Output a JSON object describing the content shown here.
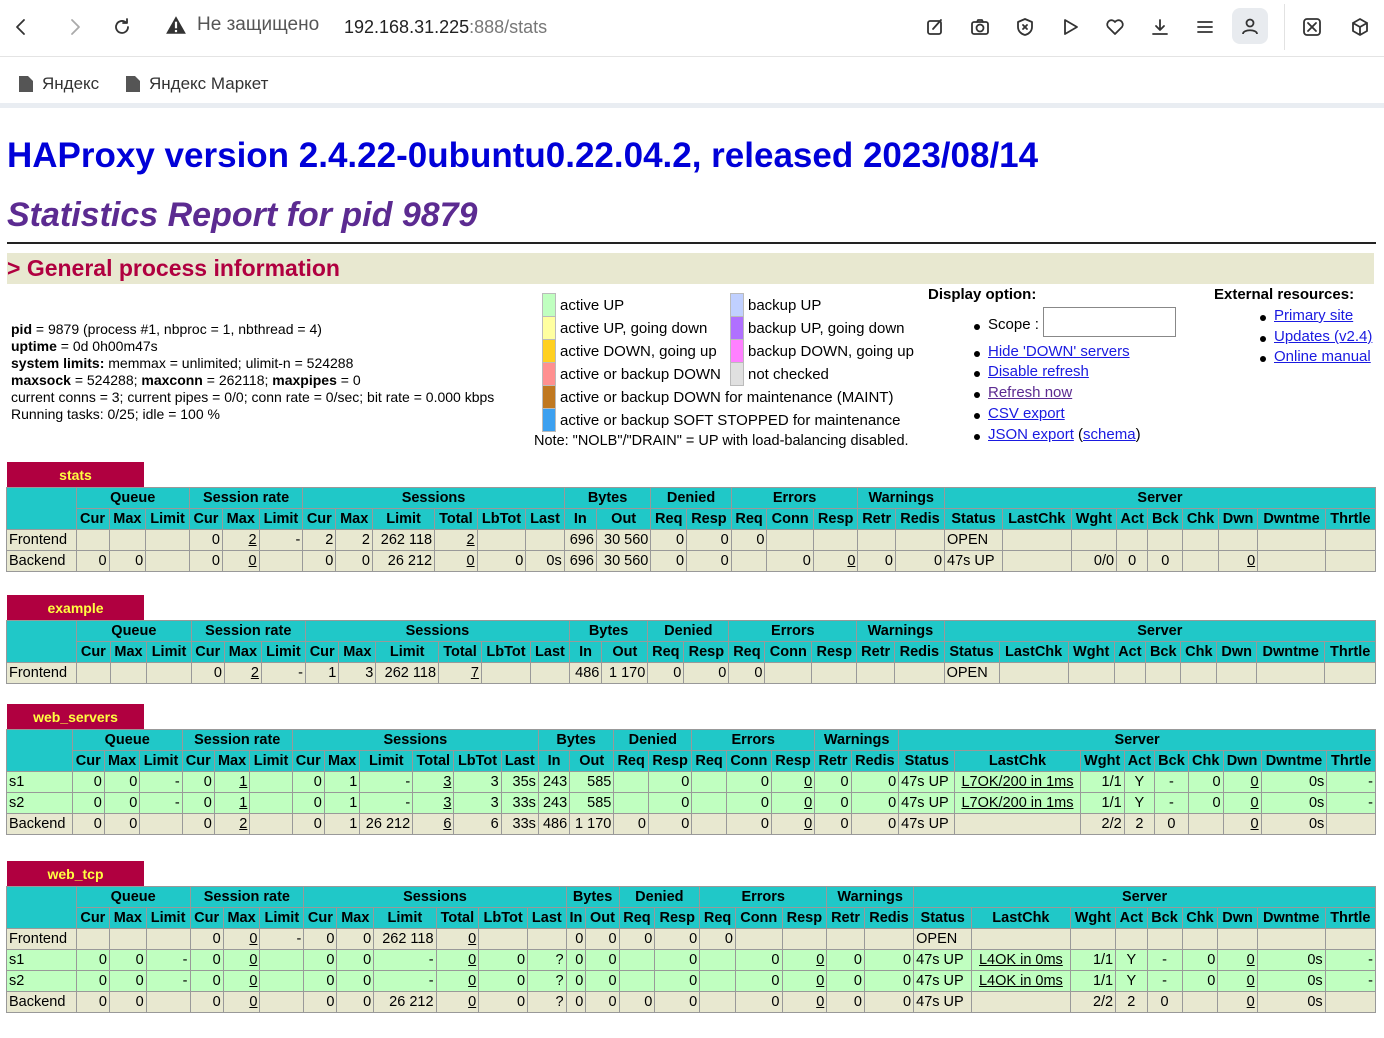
{
  "browser": {
    "security_label": "Не защищено",
    "url_host": "192.168.31.225",
    "url_rest": ":888/stats",
    "bookmarks": [
      "Яндекс",
      "Яндекс Маркет"
    ]
  },
  "header": {
    "title": "HAProxy version 2.4.22-0ubuntu0.22.04.2, released 2023/08/14",
    "subtitle": "Statistics Report for pid 9879",
    "section": "> General process information"
  },
  "process": {
    "line1_k": "pid",
    "line1_v": " = 9879 (process #1, nbproc = 1, nbthread = 4)",
    "line2_k": "uptime",
    "line2_v": " = 0d 0h00m47s",
    "line3_k": "system limits:",
    "line3_v": " memmax = unlimited; ulimit-n = 524288",
    "line4_k1": "maxsock",
    "line4_v1": " = 524288; ",
    "line4_k2": "maxconn",
    "line4_v2": " = 262118; ",
    "line4_k3": "maxpipes",
    "line4_v3": " = 0",
    "line5": "current conns = 3; current pipes = 0/0; conn rate = 0/sec; bit rate = 0.000 kbps",
    "line6": "Running tasks: 0/25; idle = 100 %"
  },
  "legend": {
    "items": [
      {
        "label": "active UP",
        "color": "#c0ffc0"
      },
      {
        "label": "active UP, going down",
        "color": "#ffffa0"
      },
      {
        "label": "active DOWN, going up",
        "color": "#ffd020"
      },
      {
        "label": "active or backup DOWN",
        "color": "#ff9090"
      },
      {
        "label": "active or backup DOWN for maintenance (MAINT)",
        "color": "#c07820"
      },
      {
        "label": "active or backup SOFT STOPPED for maintenance",
        "color": "#3ca0f0"
      },
      {
        "label": "backup UP",
        "color": "#c0d0ff"
      },
      {
        "label": "backup UP, going down",
        "color": "#b070ff"
      },
      {
        "label": "backup DOWN, going up",
        "color": "#ff80ff"
      },
      {
        "label": "not checked",
        "color": "#e0e0e0"
      }
    ],
    "note": "Note: \"NOLB\"/\"DRAIN\" = UP with load-balancing disabled."
  },
  "display": {
    "heading": "Display option:",
    "scope_label": "Scope :",
    "links": [
      "Hide 'DOWN' servers",
      "Disable refresh",
      "Refresh now",
      "CSV export",
      "JSON export"
    ],
    "schema_open": "(",
    "schema_link": "schema",
    "schema_close": ")"
  },
  "external": {
    "heading": "External resources:",
    "links": [
      "Primary site",
      "Updates (v2.4)",
      "Online manual"
    ]
  },
  "headers": {
    "groups": [
      "Queue",
      "Session rate",
      "Sessions",
      "Bytes",
      "Denied",
      "Errors",
      "Warnings",
      "Server"
    ],
    "cols": [
      "Cur",
      "Max",
      "Limit",
      "Cur",
      "Max",
      "Limit",
      "Cur",
      "Max",
      "Limit",
      "Total",
      "LbTot",
      "Last",
      "In",
      "Out",
      "Req",
      "Resp",
      "Req",
      "Conn",
      "Resp",
      "Retr",
      "Redis",
      "Status",
      "LastChk",
      "Wght",
      "Act",
      "Bck",
      "Chk",
      "Dwn",
      "Dwntme",
      "Thrtle"
    ]
  },
  "proxies": [
    {
      "name": "stats",
      "rows": [
        {
          "kind": "fe",
          "cells": [
            "Frontend",
            "",
            "",
            "",
            "0",
            "2",
            "-",
            "2",
            "2",
            "262 118",
            "2",
            "",
            "",
            "696",
            "30 560",
            "0",
            "0",
            "0",
            "",
            "",
            "",
            "",
            "OPEN",
            "",
            "",
            "",
            "",
            "",
            "",
            "",
            ""
          ]
        },
        {
          "kind": "be",
          "cells": [
            "Backend",
            "0",
            "0",
            "",
            "0",
            "0",
            "",
            "0",
            "0",
            "26 212",
            "0",
            "0",
            "0s",
            "696",
            "30 560",
            "0",
            "0",
            "",
            "0",
            "0",
            "0",
            "0",
            "47s UP",
            "",
            "0/0",
            "0",
            "0",
            "",
            "0",
            "",
            ""
          ]
        }
      ]
    },
    {
      "name": "example",
      "rows": [
        {
          "kind": "fe",
          "cells": [
            "Frontend",
            "",
            "",
            "",
            "0",
            "2",
            "-",
            "1",
            "3",
            "262 118",
            "7",
            "",
            "",
            "486",
            "1 170",
            "0",
            "0",
            "0",
            "",
            "",
            "",
            "",
            "OPEN",
            "",
            "",
            "",
            "",
            "",
            "",
            "",
            ""
          ]
        }
      ]
    },
    {
      "name": "web_servers",
      "rows": [
        {
          "kind": "up",
          "cells": [
            "s1",
            "0",
            "0",
            "-",
            "0",
            "1",
            "",
            "0",
            "1",
            "-",
            "3",
            "3",
            "35s",
            "243",
            "585",
            "",
            "0",
            "",
            "0",
            "0",
            "0",
            "0",
            "47s UP",
            "L7OK/200 in 1ms",
            "1/1",
            "Y",
            "-",
            "0",
            "0",
            "0s",
            "-"
          ]
        },
        {
          "kind": "up",
          "cells": [
            "s2",
            "0",
            "0",
            "-",
            "0",
            "1",
            "",
            "0",
            "1",
            "-",
            "3",
            "3",
            "33s",
            "243",
            "585",
            "",
            "0",
            "",
            "0",
            "0",
            "0",
            "0",
            "47s UP",
            "L7OK/200 in 1ms",
            "1/1",
            "Y",
            "-",
            "0",
            "0",
            "0s",
            "-"
          ]
        },
        {
          "kind": "be",
          "cells": [
            "Backend",
            "0",
            "0",
            "",
            "0",
            "2",
            "",
            "0",
            "1",
            "26 212",
            "6",
            "6",
            "33s",
            "486",
            "1 170",
            "0",
            "0",
            "",
            "0",
            "0",
            "0",
            "0",
            "47s UP",
            "",
            "2/2",
            "2",
            "0",
            "",
            "0",
            "0s",
            ""
          ]
        }
      ]
    },
    {
      "name": "web_tcp",
      "rows": [
        {
          "kind": "fe",
          "cells": [
            "Frontend",
            "",
            "",
            "",
            "0",
            "0",
            "-",
            "0",
            "0",
            "262 118",
            "0",
            "",
            "",
            "0",
            "0",
            "0",
            "0",
            "0",
            "",
            "",
            "",
            "",
            "OPEN",
            "",
            "",
            "",
            "",
            "",
            "",
            "",
            ""
          ]
        },
        {
          "kind": "up",
          "cells": [
            "s1",
            "0",
            "0",
            "-",
            "0",
            "0",
            "",
            "0",
            "0",
            "-",
            "0",
            "0",
            "?",
            "0",
            "0",
            "",
            "0",
            "",
            "0",
            "0",
            "0",
            "0",
            "47s UP",
            "L4OK in 0ms",
            "1/1",
            "Y",
            "-",
            "0",
            "0",
            "0s",
            "-"
          ]
        },
        {
          "kind": "up",
          "cells": [
            "s2",
            "0",
            "0",
            "-",
            "0",
            "0",
            "",
            "0",
            "0",
            "-",
            "0",
            "0",
            "?",
            "0",
            "0",
            "",
            "0",
            "",
            "0",
            "0",
            "0",
            "0",
            "47s UP",
            "L4OK in 0ms",
            "1/1",
            "Y",
            "-",
            "0",
            "0",
            "0s",
            "-"
          ]
        },
        {
          "kind": "be",
          "cells": [
            "Backend",
            "0",
            "0",
            "",
            "0",
            "0",
            "",
            "0",
            "0",
            "26 212",
            "0",
            "0",
            "?",
            "0",
            "0",
            "0",
            "0",
            "",
            "0",
            "0",
            "0",
            "0",
            "47s UP",
            "",
            "2/2",
            "2",
            "0",
            "",
            "0",
            "0s",
            ""
          ]
        }
      ]
    }
  ]
}
